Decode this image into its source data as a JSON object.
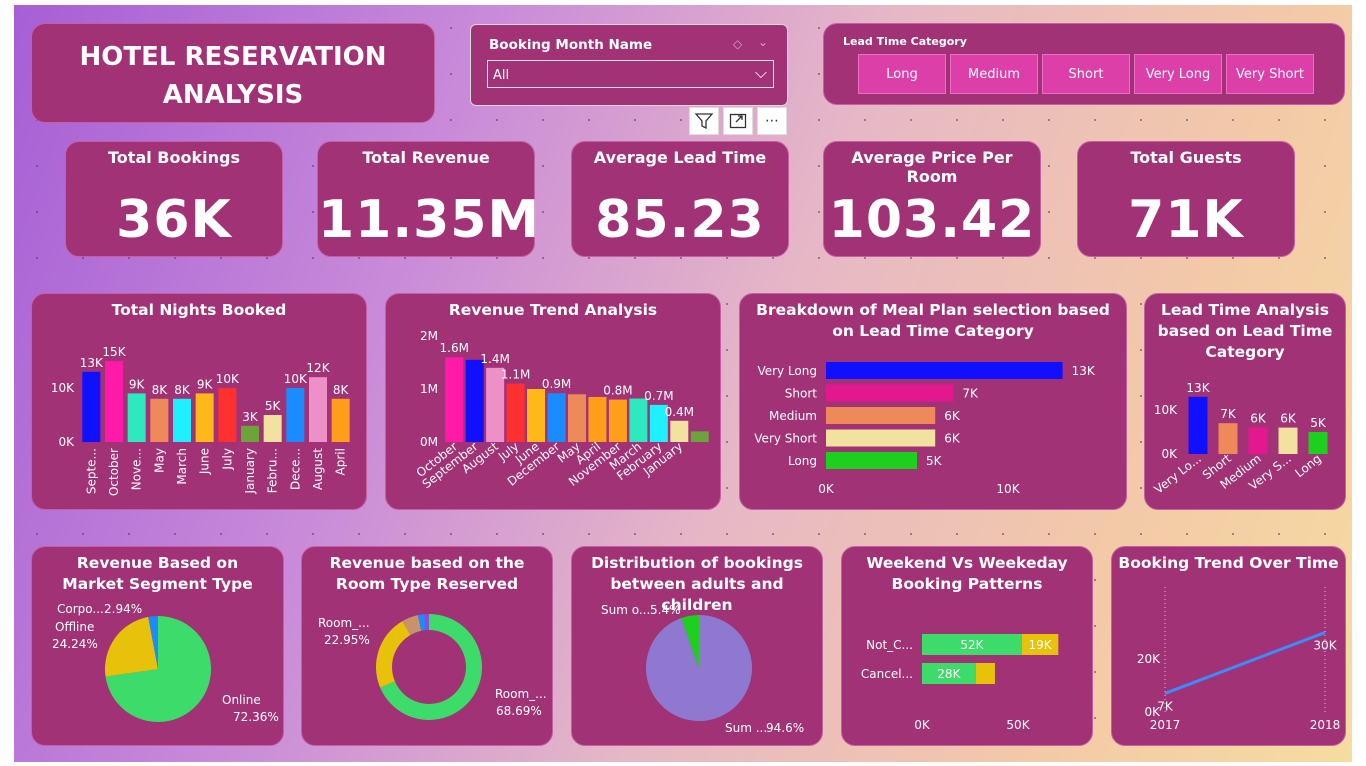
{
  "title": "HOTEL RESERVATION ANALYSIS",
  "booking_month": {
    "label": "Booking Month Name",
    "value": "All"
  },
  "lead_slicer": {
    "label": "Lead Time Category",
    "options": [
      "Long",
      "Medium",
      "Short",
      "Very Long",
      "Very Short"
    ]
  },
  "toolbar": {
    "filter_icon": "filter-icon",
    "focus_icon": "focus-mode-icon",
    "more_icon": "more-options-icon",
    "more_label": "⋯"
  },
  "kpis": [
    {
      "label": "Total Bookings",
      "value": "36K"
    },
    {
      "label": "Total Revenue",
      "value": "11.35M"
    },
    {
      "label": "Average Lead Time",
      "value": "85.23"
    },
    {
      "label": "Average Price Per Room",
      "value": "103.42"
    },
    {
      "label": "Total Guests",
      "value": "71K"
    }
  ],
  "charts": {
    "nights": {
      "title": "Total Nights Booked"
    },
    "revenue_trend": {
      "title": "Revenue Trend Analysis"
    },
    "meal": {
      "title": "Breakdown of Meal Plan selection based on Lead Time Category"
    },
    "lead": {
      "title": "Lead Time Analysis based on Lead Time Category"
    },
    "market": {
      "title": "Revenue Based on Market Segment Type"
    },
    "room": {
      "title": "Revenue based on the Room Type Reserved"
    },
    "adults": {
      "title": "Distribution of bookings between adults and children"
    },
    "weekend": {
      "title": "Weekend Vs Weekeday Booking Patterns"
    },
    "trend": {
      "title": "Booking Trend Over Time"
    }
  },
  "chart_data": [
    {
      "id": "nights",
      "type": "bar",
      "categories": [
        "Septe...",
        "October",
        "Nove...",
        "May",
        "March",
        "June",
        "July",
        "January",
        "Febru...",
        "Dece...",
        "August",
        "April"
      ],
      "values": [
        13,
        15,
        9,
        8,
        8,
        9,
        10,
        3,
        5,
        10,
        12,
        8
      ],
      "labels": [
        "13K",
        "15K",
        "9K",
        "8K",
        "8K",
        "9K",
        "10K",
        "3K",
        "5K",
        "10K",
        "12K",
        "8K"
      ],
      "yticks": [
        "0K",
        "10K"
      ],
      "colors": [
        "#1010ff",
        "#ff1aa8",
        "#2ee8c0",
        "#ee8a5a",
        "#1ff0ff",
        "#ffb81a",
        "#ff3030",
        "#6aa43a",
        "#f2e2a0",
        "#1a8cff",
        "#ee90c8",
        "#ff9e1a"
      ]
    },
    {
      "id": "revenue_trend",
      "type": "bar",
      "categories": [
        "October",
        "September",
        "August",
        "July",
        "June",
        "December",
        "May",
        "April",
        "November",
        "March",
        "February",
        "January"
      ],
      "values": [
        1.6,
        1.55,
        1.4,
        1.1,
        1.0,
        0.92,
        0.9,
        0.85,
        0.8,
        0.82,
        0.7,
        0.4,
        0.2
      ],
      "labels": [
        "1.6M",
        "",
        "1.4M",
        "1.1M",
        "",
        "0.9M",
        "",
        "",
        "0.8M",
        "",
        "0.7M",
        "0.4M"
      ],
      "yticks": [
        "0M",
        "1M",
        "2M"
      ],
      "colors": [
        "#ff1aa8",
        "#1010ff",
        "#ee90c8",
        "#ff3030",
        "#ffb81a",
        "#1a8cff",
        "#ee8a5a",
        "#ff9e1a",
        "#ff9e1a",
        "#2ee8c0",
        "#1ff0ff",
        "#f2e2a0",
        "#6aa43a"
      ]
    },
    {
      "id": "meal",
      "type": "bar",
      "categories": [
        "Very Long",
        "Short",
        "Medium",
        "Very Short",
        "Long"
      ],
      "values": [
        13,
        7,
        6,
        6,
        5
      ],
      "labels": [
        "13K",
        "7K",
        "6K",
        "6K",
        "5K"
      ],
      "xticks": [
        "0K",
        "10K"
      ],
      "colors": [
        "#1010ff",
        "#e3188f",
        "#ee8a5a",
        "#f2e2a0",
        "#1ed01e"
      ]
    },
    {
      "id": "lead",
      "type": "bar",
      "categories": [
        "Very Lo...",
        "Short",
        "Medium",
        "Very S...",
        "Long"
      ],
      "values": [
        13,
        7,
        6,
        6,
        5
      ],
      "labels": [
        "13K",
        "7K",
        "6K",
        "6K",
        "5K"
      ],
      "yticks": [
        "0K",
        "10K"
      ],
      "colors": [
        "#1010ff",
        "#ee8a5a",
        "#e3188f",
        "#f2e2a0",
        "#1ed01e"
      ]
    },
    {
      "id": "market",
      "type": "pie",
      "slices": [
        {
          "name": "Online",
          "value": 72.36,
          "label": "72.36%",
          "color": "#3ddc6a"
        },
        {
          "name": "Offline",
          "value": 24.24,
          "label": "24.24%",
          "color": "#e8c20a"
        },
        {
          "name": "Corpo...",
          "value": 2.94,
          "label": "2.94%",
          "color": "#1a8cff"
        }
      ]
    },
    {
      "id": "room",
      "type": "pie",
      "slices": [
        {
          "name": "Room_...",
          "value": 68.69,
          "label": "68.69%",
          "color": "#3ddc6a"
        },
        {
          "name": "Room_...",
          "value": 22.95,
          "label": "22.95%",
          "color": "#e8c20a"
        },
        {
          "name": "",
          "value": 5.0,
          "color": "#c8936a"
        },
        {
          "name": "",
          "value": 2.0,
          "color": "#1a8cff"
        },
        {
          "name": "",
          "value": 1.36,
          "color": "#8a50d0"
        }
      ]
    },
    {
      "id": "adults",
      "type": "pie",
      "slices": [
        {
          "name": "Sum ...",
          "value": 94.6,
          "label": "94.6%",
          "color": "#8f78d0"
        },
        {
          "name": "Sum o...",
          "value": 5.4,
          "label": "5.4%",
          "color": "#1ed01e"
        }
      ]
    },
    {
      "id": "weekend",
      "type": "bar",
      "categories": [
        "Not_C...",
        "Cancel..."
      ],
      "series": [
        {
          "values": [
            52,
            28
          ],
          "labels": [
            "52K",
            "28K"
          ],
          "color": "#3ddc6a"
        },
        {
          "values": [
            19,
            10
          ],
          "labels": [
            "19K",
            ""
          ],
          "color": "#e8c20a"
        }
      ],
      "xticks": [
        "0K",
        "50K"
      ]
    },
    {
      "id": "trend",
      "type": "line",
      "x": [
        "2017",
        "2018"
      ],
      "values": [
        7,
        30
      ],
      "labels": [
        "7K",
        "30K"
      ],
      "yticks": [
        "0K",
        "20K"
      ],
      "color": "#3b8cff"
    }
  ]
}
